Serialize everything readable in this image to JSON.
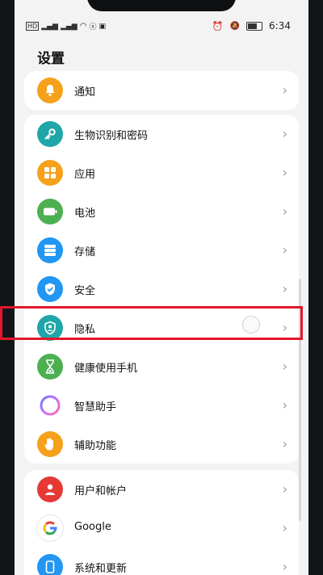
{
  "status": {
    "left_icons": [
      "HD",
      "4G",
      "4G",
      "wifi",
      "signal",
      "message",
      "video"
    ],
    "network_label_1": "⁴⁶ₗ",
    "network_label_2": "⁴⁶ₗ",
    "time": "6:34",
    "right_icons": [
      "alarm-icon",
      "mute-icon",
      "battery-icon"
    ]
  },
  "page": {
    "title": "设置"
  },
  "groups": [
    {
      "items": [
        {
          "label": "通知",
          "icon": "bell-icon",
          "color": "#f5a11c"
        }
      ]
    },
    {
      "items": [
        {
          "label": "生物识别和密码",
          "icon": "key-icon",
          "color": "#1fa6a8"
        },
        {
          "label": "应用",
          "icon": "grid-icon",
          "color": "#f5a11c"
        },
        {
          "label": "电池",
          "icon": "battery-icon",
          "color": "#4caf50"
        },
        {
          "label": "存储",
          "icon": "storage-icon",
          "color": "#2196f3"
        },
        {
          "label": "安全",
          "icon": "shield-check-icon",
          "color": "#2196f3"
        },
        {
          "label": "隐私",
          "icon": "privacy-icon",
          "color": "#1fa6a8"
        },
        {
          "label": "健康使用手机",
          "icon": "hourglass-icon",
          "color": "#4caf50"
        },
        {
          "label": "智慧助手",
          "icon": "assistant-orb-icon",
          "color": "#b06cff"
        },
        {
          "label": "辅助功能",
          "icon": "hand-icon",
          "color": "#f5a11c"
        }
      ]
    },
    {
      "items": [
        {
          "label": "用户和帐户",
          "icon": "user-icon",
          "color": "#e53935"
        },
        {
          "label": "Google",
          "icon": "google-icon",
          "color": "#ffffff"
        },
        {
          "label": "系统和更新",
          "icon": "phone-update-icon",
          "color": "#2196f3"
        }
      ]
    }
  ],
  "highlight_label": "隐私"
}
